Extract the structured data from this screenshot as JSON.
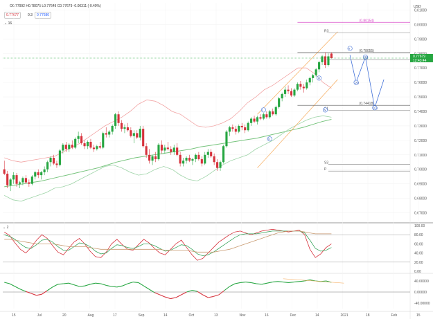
{
  "header": {
    "ohlc": "O0.77992  H0.78075  L0.77649  C0.77679  -0.00311 (-0.40%)",
    "bid": "0.77677",
    "spread": "0.3",
    "ask": "0.77680",
    "interval": "16"
  },
  "currency": "USD",
  "colors": {
    "up": "#26a641",
    "down": "#d6323c",
    "upper_band": "#f2a4a4",
    "lower_band": "#9cd3a6",
    "ma_long": "#77c47d",
    "channel": "#f7b36b",
    "last_price": "#26a641",
    "target_line": "#d94fc9"
  },
  "chart_data": [
    {
      "type": "candlestick",
      "title": "",
      "ylim": [
        0.665,
        0.815
      ],
      "y_ticks": [
        "0.81000",
        "0.80000",
        "0.79000",
        "0.78000",
        "0.77000",
        "0.76000",
        "0.75000",
        "0.74000",
        "0.73000",
        "0.72000",
        "0.71000",
        "0.70000",
        "0.69000",
        "0.68000",
        "0.67000"
      ],
      "x_ticks": [
        "15",
        "Jul",
        "20",
        "Aug",
        "17",
        "Sep",
        "14",
        "Oct",
        "13",
        "Nov",
        "16",
        "Dec",
        "14",
        "2021",
        "18",
        "Feb",
        "15"
      ],
      "last_price": {
        "value": "0.77679",
        "time": "12:43:44"
      },
      "candles": [
        [
          0.7,
          0.706,
          0.696,
          0.697
        ],
        [
          0.697,
          0.699,
          0.687,
          0.689
        ],
        [
          0.689,
          0.694,
          0.685,
          0.693
        ],
        [
          0.693,
          0.698,
          0.69,
          0.696
        ],
        [
          0.696,
          0.6975,
          0.688,
          0.69
        ],
        [
          0.69,
          0.692,
          0.687,
          0.691
        ],
        [
          0.691,
          0.695,
          0.689,
          0.694
        ],
        [
          0.694,
          0.696,
          0.69,
          0.691
        ],
        [
          0.691,
          0.693,
          0.688,
          0.69
        ],
        [
          0.69,
          0.696,
          0.689,
          0.695
        ],
        [
          0.695,
          0.699,
          0.693,
          0.698
        ],
        [
          0.698,
          0.7,
          0.694,
          0.696
        ],
        [
          0.696,
          0.699,
          0.693,
          0.698
        ],
        [
          0.698,
          0.702,
          0.696,
          0.7
        ],
        [
          0.7,
          0.706,
          0.698,
          0.705
        ],
        [
          0.705,
          0.709,
          0.702,
          0.708
        ],
        [
          0.708,
          0.71,
          0.703,
          0.704
        ],
        [
          0.704,
          0.706,
          0.701,
          0.703
        ],
        [
          0.703,
          0.714,
          0.702,
          0.713
        ],
        [
          0.713,
          0.718,
          0.711,
          0.717
        ],
        [
          0.717,
          0.719,
          0.712,
          0.714
        ],
        [
          0.714,
          0.718,
          0.712,
          0.717
        ],
        [
          0.717,
          0.72,
          0.714,
          0.715
        ],
        [
          0.715,
          0.722,
          0.714,
          0.721
        ],
        [
          0.721,
          0.726,
          0.718,
          0.723
        ],
        [
          0.723,
          0.725,
          0.717,
          0.718
        ],
        [
          0.718,
          0.72,
          0.714,
          0.716
        ],
        [
          0.716,
          0.72,
          0.714,
          0.719
        ],
        [
          0.719,
          0.721,
          0.714,
          0.715
        ],
        [
          0.715,
          0.717,
          0.712,
          0.714
        ],
        [
          0.714,
          0.717,
          0.713,
          0.716
        ],
        [
          0.716,
          0.719,
          0.714,
          0.715
        ],
        [
          0.715,
          0.726,
          0.714,
          0.725
        ],
        [
          0.725,
          0.729,
          0.722,
          0.724
        ],
        [
          0.724,
          0.727,
          0.722,
          0.726
        ],
        [
          0.726,
          0.731,
          0.724,
          0.73
        ],
        [
          0.73,
          0.739,
          0.728,
          0.738
        ],
        [
          0.738,
          0.74,
          0.73,
          0.732
        ],
        [
          0.732,
          0.734,
          0.726,
          0.728
        ],
        [
          0.728,
          0.731,
          0.725,
          0.729
        ],
        [
          0.729,
          0.732,
          0.726,
          0.727
        ],
        [
          0.727,
          0.729,
          0.722,
          0.723
        ],
        [
          0.723,
          0.727,
          0.718,
          0.725
        ],
        [
          0.725,
          0.727,
          0.721,
          0.722
        ],
        [
          0.722,
          0.73,
          0.72,
          0.728
        ],
        [
          0.728,
          0.73,
          0.715,
          0.716
        ],
        [
          0.716,
          0.718,
          0.708,
          0.71
        ],
        [
          0.71,
          0.714,
          0.704,
          0.706
        ],
        [
          0.706,
          0.71,
          0.703,
          0.709
        ],
        [
          0.709,
          0.712,
          0.705,
          0.707
        ],
        [
          0.707,
          0.718,
          0.706,
          0.717
        ],
        [
          0.717,
          0.72,
          0.711,
          0.713
        ],
        [
          0.713,
          0.717,
          0.711,
          0.715
        ],
        [
          0.715,
          0.719,
          0.713,
          0.714
        ],
        [
          0.714,
          0.716,
          0.71,
          0.712
        ],
        [
          0.712,
          0.717,
          0.71,
          0.715
        ],
        [
          0.715,
          0.718,
          0.709,
          0.71
        ],
        [
          0.71,
          0.712,
          0.702,
          0.704
        ],
        [
          0.704,
          0.708,
          0.702,
          0.706
        ],
        [
          0.706,
          0.709,
          0.704,
          0.708
        ],
        [
          0.708,
          0.71,
          0.705,
          0.706
        ],
        [
          0.706,
          0.708,
          0.703,
          0.707
        ],
        [
          0.707,
          0.711,
          0.705,
          0.71
        ],
        [
          0.71,
          0.712,
          0.706,
          0.707
        ],
        [
          0.707,
          0.709,
          0.702,
          0.704
        ],
        [
          0.704,
          0.712,
          0.703,
          0.71
        ],
        [
          0.71,
          0.714,
          0.708,
          0.712
        ],
        [
          0.712,
          0.714,
          0.708,
          0.709
        ],
        [
          0.709,
          0.711,
          0.703,
          0.705
        ],
        [
          0.705,
          0.707,
          0.699,
          0.701
        ],
        [
          0.701,
          0.706,
          0.699,
          0.705
        ],
        [
          0.705,
          0.717,
          0.704,
          0.716
        ],
        [
          0.716,
          0.727,
          0.715,
          0.726
        ],
        [
          0.726,
          0.73,
          0.723,
          0.729
        ],
        [
          0.729,
          0.731,
          0.726,
          0.728
        ],
        [
          0.728,
          0.73,
          0.724,
          0.726
        ],
        [
          0.726,
          0.731,
          0.725,
          0.73
        ],
        [
          0.73,
          0.732,
          0.727,
          0.729
        ],
        [
          0.729,
          0.731,
          0.725,
          0.727
        ],
        [
          0.727,
          0.733,
          0.726,
          0.732
        ],
        [
          0.732,
          0.736,
          0.73,
          0.735
        ],
        [
          0.735,
          0.737,
          0.732,
          0.733
        ],
        [
          0.733,
          0.737,
          0.731,
          0.736
        ],
        [
          0.736,
          0.738,
          0.734,
          0.735
        ],
        [
          0.735,
          0.739,
          0.734,
          0.738
        ],
        [
          0.738,
          0.74,
          0.735,
          0.736
        ],
        [
          0.736,
          0.741,
          0.735,
          0.74
        ],
        [
          0.74,
          0.742,
          0.737,
          0.738
        ],
        [
          0.738,
          0.744,
          0.737,
          0.743
        ],
        [
          0.743,
          0.75,
          0.742,
          0.749
        ],
        [
          0.749,
          0.753,
          0.747,
          0.752
        ],
        [
          0.752,
          0.757,
          0.75,
          0.755
        ],
        [
          0.755,
          0.758,
          0.752,
          0.754
        ],
        [
          0.754,
          0.756,
          0.75,
          0.751
        ],
        [
          0.751,
          0.756,
          0.75,
          0.755
        ],
        [
          0.755,
          0.76,
          0.754,
          0.759
        ],
        [
          0.759,
          0.761,
          0.755,
          0.757
        ],
        [
          0.757,
          0.759,
          0.753,
          0.756
        ],
        [
          0.756,
          0.762,
          0.755,
          0.76
        ],
        [
          0.76,
          0.764,
          0.758,
          0.763
        ],
        [
          0.763,
          0.766,
          0.76,
          0.765
        ],
        [
          0.765,
          0.77,
          0.764,
          0.769
        ],
        [
          0.769,
          0.775,
          0.767,
          0.774
        ],
        [
          0.774,
          0.779,
          0.772,
          0.778
        ],
        [
          0.778,
          0.7808,
          0.77,
          0.772
        ],
        [
          0.772,
          0.78,
          0.771,
          0.778
        ],
        [
          0.7799,
          0.7808,
          0.7765,
          0.7768
        ]
      ],
      "upper_band": [
        0.708,
        0.706,
        0.705,
        0.706,
        0.707,
        0.708,
        0.709,
        0.712,
        0.715,
        0.718,
        0.722,
        0.726,
        0.73,
        0.733,
        0.736,
        0.74,
        0.745,
        0.748,
        0.747,
        0.744,
        0.74,
        0.738,
        0.734,
        0.73,
        0.729,
        0.73,
        0.732,
        0.735,
        0.74,
        0.746,
        0.75,
        0.755,
        0.758,
        0.762,
        0.766,
        0.77,
        0.77,
        0.766,
        0.76,
        0.756
      ],
      "lower_band": [
        0.682,
        0.679,
        0.678,
        0.68,
        0.682,
        0.684,
        0.687,
        0.688,
        0.69,
        0.693,
        0.696,
        0.699,
        0.702,
        0.703,
        0.701,
        0.698,
        0.696,
        0.697,
        0.7,
        0.702,
        0.7,
        0.696,
        0.693,
        0.692,
        0.695,
        0.699,
        0.703,
        0.706,
        0.708,
        0.71,
        0.714,
        0.717,
        0.72,
        0.724,
        0.728,
        0.731,
        0.734,
        0.736,
        0.737,
        0.736
      ],
      "ma_long": [
        0.688,
        0.689,
        0.69,
        0.691,
        0.692,
        0.6935,
        0.695,
        0.6965,
        0.698,
        0.6995,
        0.701,
        0.703,
        0.705,
        0.7065,
        0.708,
        0.709,
        0.71,
        0.711,
        0.712,
        0.713,
        0.714,
        0.7155,
        0.7165,
        0.7175,
        0.7185,
        0.7195,
        0.7205,
        0.7215,
        0.723,
        0.7245,
        0.726,
        0.7275,
        0.729,
        0.731,
        0.733,
        0.7345
      ],
      "channel": {
        "upper": [
          0.738,
          0.795
        ],
        "lower": [
          0.701,
          0.762
        ],
        "x_range": [
          82,
          108
        ]
      },
      "levels": [
        {
          "label": "(0.80154)",
          "value": 0.8015,
          "color": "#d94fc9"
        },
        {
          "label": "(0.78055)",
          "value": 0.7806,
          "color": "#555555"
        },
        {
          "label": "(0.74418)",
          "value": 0.7442,
          "color": "#555555"
        },
        {
          "label": "R3",
          "value": 0.7942,
          "color": "#999999"
        },
        {
          "label": "R1",
          "value": 0.7756,
          "color": "#999999"
        },
        {
          "label": "S1",
          "value": 0.7408,
          "color": "#999999"
        },
        {
          "label": "S3",
          "value": 0.7034,
          "color": "#999999"
        },
        {
          "label": "P",
          "value": 0.6988,
          "color": "#999999"
        }
      ],
      "wave_labels": [
        {
          "text": "i",
          "index": 84,
          "value": 0.741
        },
        {
          "text": "ii",
          "index": 86,
          "value": 0.721
        },
        {
          "text": "iii",
          "index": 102,
          "value": 0.763
        },
        {
          "text": "iv",
          "index": 104,
          "value": 0.741
        },
        {
          "text": "v",
          "index": 112,
          "value": 0.7835
        },
        {
          "text": "(B)",
          "index": 117,
          "value": 0.7775
        },
        {
          "text": "(A)",
          "index": 114,
          "value": 0.76
        },
        {
          "text": "(C)",
          "index": 120,
          "value": 0.7425
        }
      ]
    },
    {
      "type": "line",
      "title": "",
      "ylim": [
        0,
        100
      ],
      "y_ticks": [
        "100.00",
        "80.00",
        "60.00",
        "40.00",
        "20.00",
        "0.00"
      ],
      "series": [
        {
          "color": "#d6323c",
          "values": [
            86,
            78,
            62,
            48,
            40,
            52,
            68,
            80,
            72,
            56,
            42,
            36,
            50,
            64,
            72,
            60,
            44,
            32,
            30,
            42,
            60,
            70,
            58,
            48,
            46,
            58,
            70,
            62,
            50,
            40,
            36,
            48,
            60,
            68,
            52,
            36,
            24,
            28,
            40,
            52,
            64,
            72,
            80,
            86,
            88,
            84,
            80,
            84,
            88,
            90,
            92,
            90,
            88,
            86,
            88,
            90,
            80,
            48,
            30,
            38,
            52,
            60
          ]
        },
        {
          "color": "#3aa55d",
          "values": [
            80,
            76,
            70,
            60,
            52,
            50,
            58,
            68,
            70,
            64,
            54,
            46,
            46,
            54,
            62,
            60,
            54,
            44,
            38,
            40,
            50,
            58,
            56,
            52,
            50,
            54,
            60,
            60,
            56,
            50,
            44,
            46,
            52,
            58,
            56,
            48,
            38,
            34,
            36,
            42,
            50,
            58,
            66,
            74,
            80,
            82,
            82,
            82,
            84,
            86,
            88,
            88,
            88,
            88,
            88,
            88,
            84,
            68,
            50,
            44,
            46,
            52
          ]
        },
        {
          "color": "#c89a70",
          "values": [
            70,
            70,
            68,
            66,
            64,
            62,
            60,
            60,
            60,
            60,
            58,
            56,
            54,
            54,
            54,
            54,
            52,
            50,
            48,
            48,
            48,
            48,
            48,
            48,
            48,
            48,
            48,
            48,
            48,
            48,
            46,
            46,
            46,
            46,
            46,
            44,
            42,
            42,
            42,
            42,
            44,
            46,
            48,
            52,
            56,
            60,
            64,
            68,
            72,
            76,
            80,
            84,
            86,
            88,
            88,
            88,
            86,
            84,
            82,
            82,
            82,
            82
          ]
        }
      ],
      "hlines": [
        80,
        20
      ]
    },
    {
      "type": "line",
      "title": "",
      "ylim": [
        -0.06,
        0.06
      ],
      "y_ticks": [
        "40.00000",
        "0.00000",
        "-40.00000"
      ],
      "series": [
        {
          "color": "#3aa55d",
          "values": [
            0.035,
            0.03,
            0.02,
            0.01,
            0.002,
            -0.005,
            -0.012,
            -0.008,
            0.005,
            0.018,
            0.028,
            0.03,
            0.032,
            0.026,
            0.02,
            0.022,
            0.028,
            0.032,
            0.03,
            0.024,
            0.02,
            0.018,
            0.022,
            0.03,
            0.036,
            0.034,
            0.022,
            0.01,
            -0.002,
            -0.01,
            -0.018,
            -0.024,
            -0.02,
            -0.01,
            0.0,
            0.006,
            0.002,
            -0.01,
            -0.02,
            -0.016,
            -0.01,
            0.005,
            0.02,
            0.03,
            0.034,
            0.036,
            0.034,
            0.03,
            0.028,
            0.032,
            0.036,
            0.038,
            0.036,
            0.034,
            0.036,
            0.038,
            0.04,
            0.044,
            0.04,
            0.038,
            0.04,
            0.035
          ]
        }
      ],
      "trend": {
        "from": [
          52,
          0.048
        ],
        "to": [
          61,
          0.032
        ],
        "color": "#f7b36b"
      }
    }
  ]
}
